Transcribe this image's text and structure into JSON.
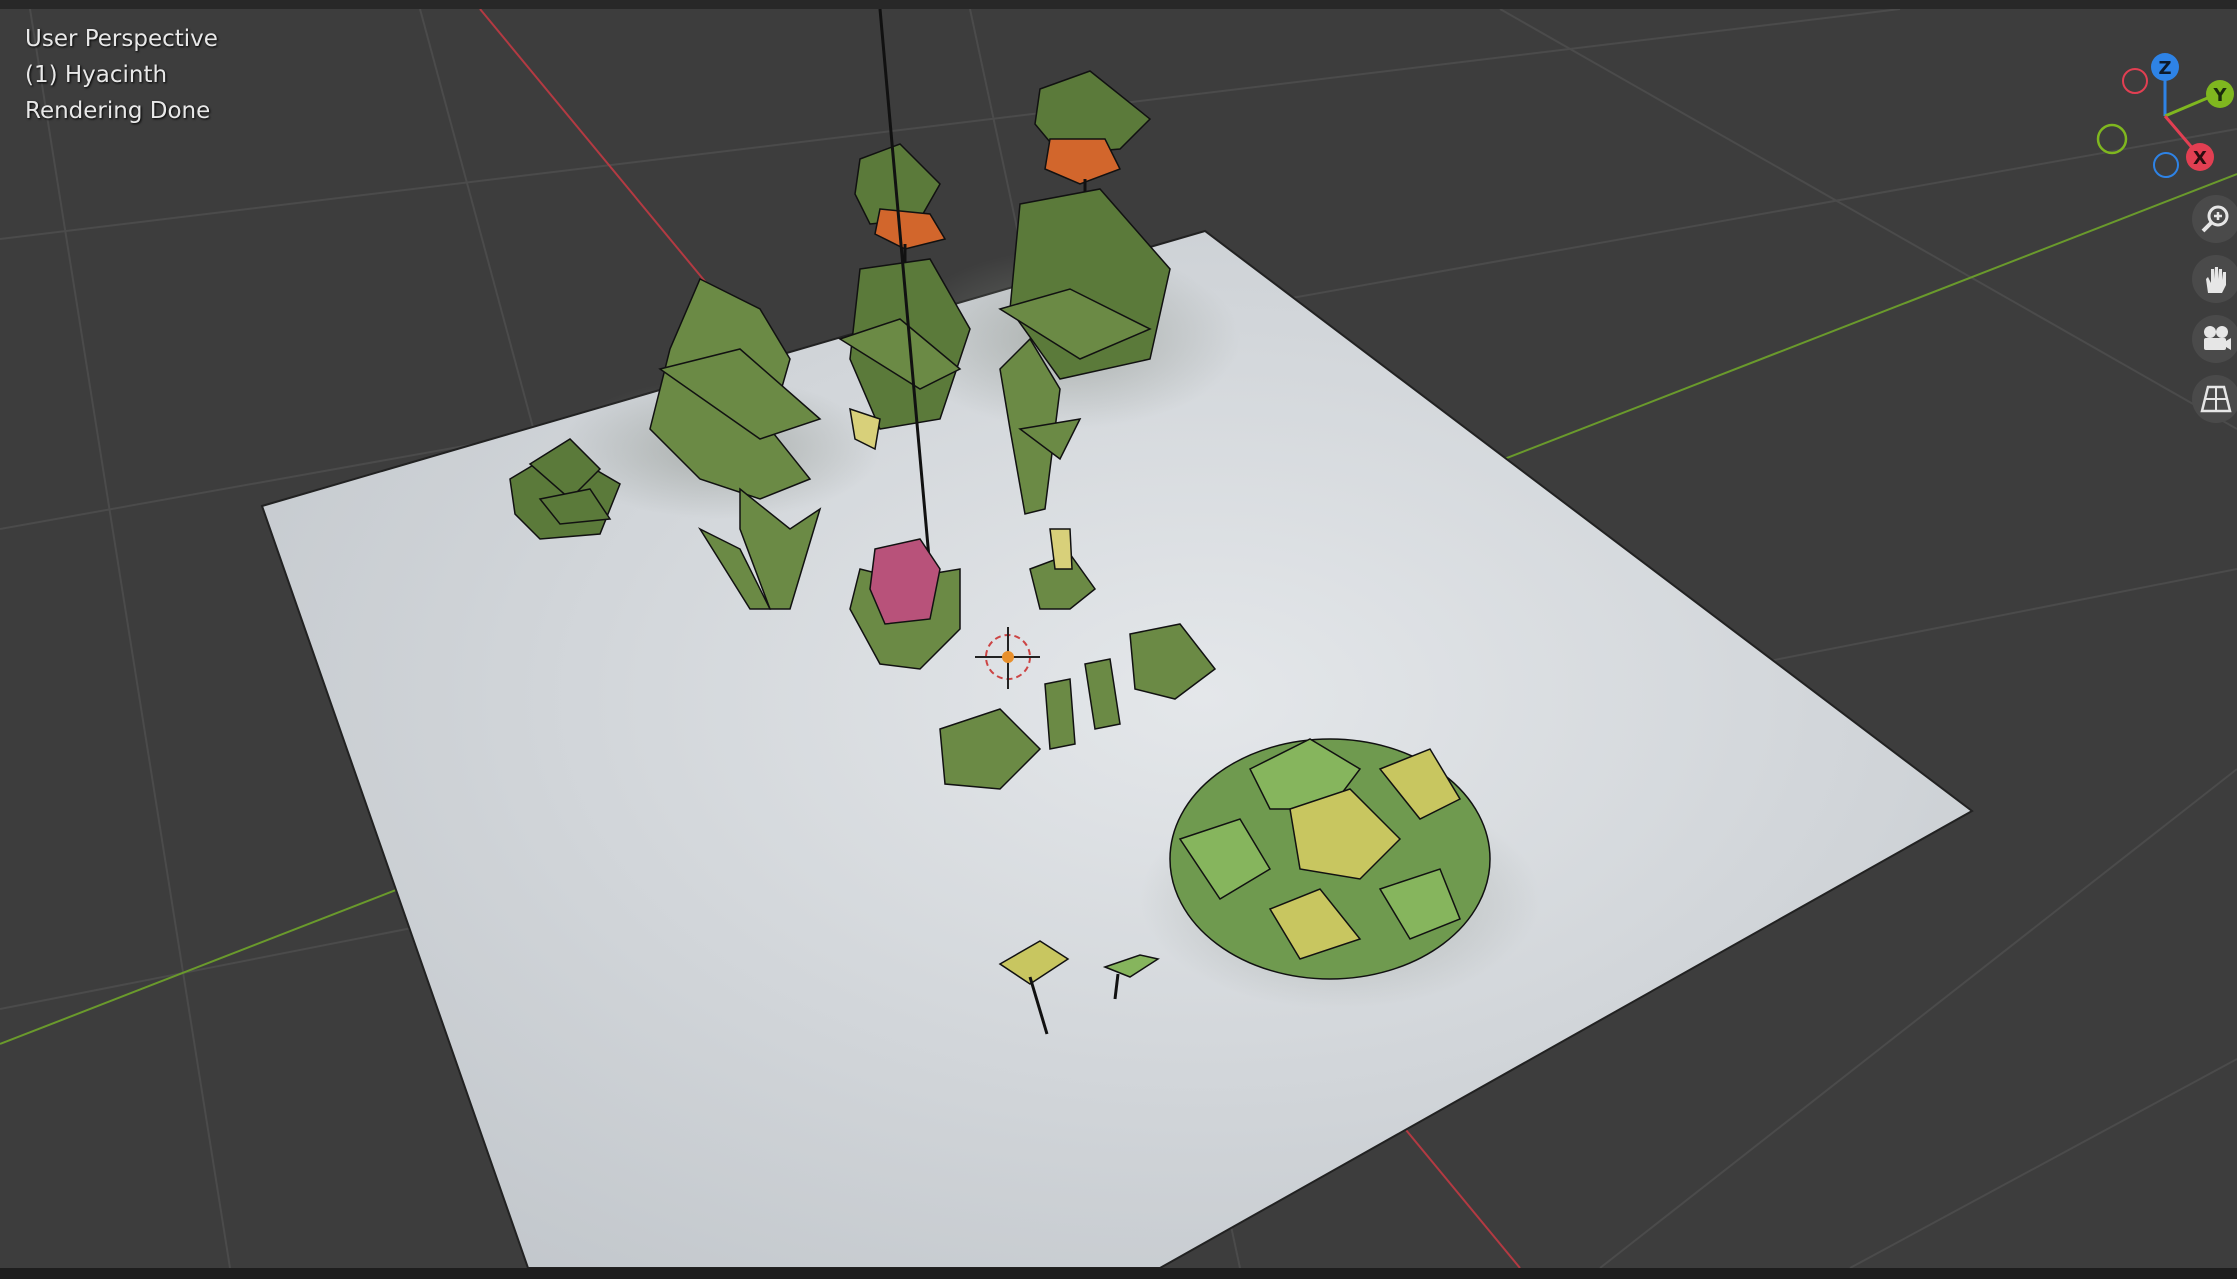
{
  "viewport": {
    "perspective_label": "User Perspective",
    "object_label": "(1) Hyacinth",
    "status_label": "Rendering Done"
  },
  "gizmo": {
    "z_label": "Z",
    "y_label": "Y",
    "x_label": "X",
    "z_color": "#2e83e6",
    "y_color": "#7fb71f",
    "x_color": "#e23f52"
  },
  "nav_buttons": [
    "zoom-icon",
    "hand-pan-icon",
    "camera-icon",
    "perspective-grid-icon"
  ],
  "colors": {
    "background": "#3d3d3d",
    "grid_line": "#4a4a4a",
    "x_axis": "#b33a42",
    "y_axis": "#6a9a2c",
    "ground_plane": "#d2d6da",
    "leaf_green": "#5b7a3a",
    "flower_orange": "#d2662c",
    "hyacinth_pink": "#b8527a"
  }
}
